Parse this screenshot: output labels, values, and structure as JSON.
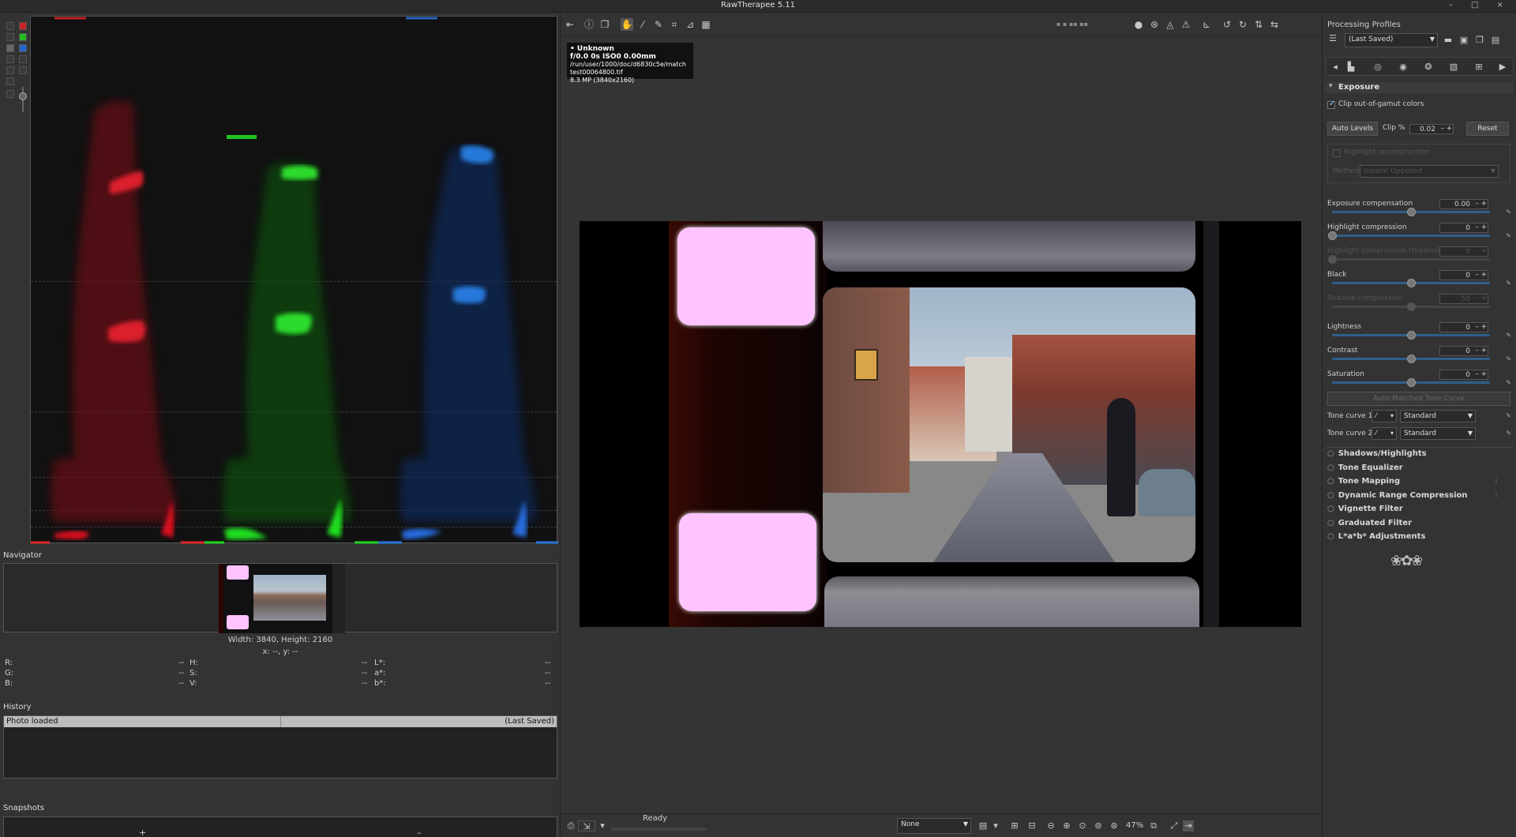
{
  "window": {
    "title": "RawTherapee 5.11",
    "controls": "– □ ×"
  },
  "histogram": {
    "colors": {
      "red": "#e0262b",
      "green": "#22d222",
      "blue": "#2a74d8"
    },
    "tool_icons": [
      "histogram-mode-icon",
      "red-channel-icon",
      "green-channel-icon",
      "blue-channel-icon",
      "luminance-icon",
      "chroma-icon",
      "raw-icon",
      "bar-icon"
    ]
  },
  "navigator": {
    "label": "Navigator",
    "size_text": "Width: 3840, Height: 2160",
    "coords_text": "x: --, y: --",
    "rows": [
      {
        "a": "R:",
        "av": "--",
        "b": "H:",
        "bv": "--",
        "c": "L*:",
        "cv": "--"
      },
      {
        "a": "G:",
        "av": "--",
        "b": "S:",
        "bv": "--",
        "c": "a*:",
        "cv": "--"
      },
      {
        "a": "B:",
        "av": "--",
        "b": "V:",
        "bv": "--",
        "c": "b*:",
        "cv": "--"
      }
    ]
  },
  "history": {
    "label": "History",
    "row_action": "Photo loaded",
    "row_profile": "(Last Saved)"
  },
  "snapshots": {
    "label": "Snapshots",
    "add": "+",
    "remove": "–"
  },
  "info": {
    "camera": "• Unknown",
    "exposure": "f/0.0  0s  ISO0  0.00mm",
    "path": "/run/user/1000/doc/d6830c5e/match test00064800.tif",
    "mp": "8.3 MP (3840x2160)"
  },
  "status": {
    "text": "Ready"
  },
  "bottom": {
    "none_combo": "None",
    "zoom": "47%"
  },
  "profiles": {
    "label": "Processing Profiles",
    "current": "(Last Saved)"
  },
  "exposure": {
    "title": "Exposure",
    "clip_label": "Clip out-of-gamut colors",
    "auto_levels": "Auto Levels",
    "clip_pct_label": "Clip %",
    "clip_pct": "0.02",
    "reset": "Reset",
    "hl_recon": "Highlight reconstruction",
    "method_label": "Method",
    "method_value": "Inpaint Opposed",
    "sliders": [
      {
        "label": "Exposure compensation",
        "value": "0.00",
        "pos": 0.5
      },
      {
        "label": "Highlight compression",
        "value": "0",
        "pos": 0.0
      },
      {
        "label": "Highlight compression threshold",
        "value": "0",
        "pos": 0.0
      },
      {
        "label": "Black",
        "value": "0",
        "pos": 0.5
      },
      {
        "label": "Shadow compression",
        "value": "50",
        "pos": 0.5
      },
      {
        "label": "Lightness",
        "value": "0",
        "pos": 0.5
      },
      {
        "label": "Contrast",
        "value": "0",
        "pos": 0.5
      },
      {
        "label": "Saturation",
        "value": "0",
        "pos": 0.5
      }
    ],
    "auto_curve": "Auto-Matched Tone Curve",
    "tone1_label": "Tone curve 1:",
    "tone2_label": "Tone curve 2:",
    "tone_mode": "Standard"
  },
  "tools": [
    "Shadows/Highlights",
    "Tone Equalizer",
    "Tone Mapping",
    "Dynamic Range Compression",
    "Vignette Filter",
    "Graduated Filter",
    "L*a*b* Adjustments"
  ]
}
